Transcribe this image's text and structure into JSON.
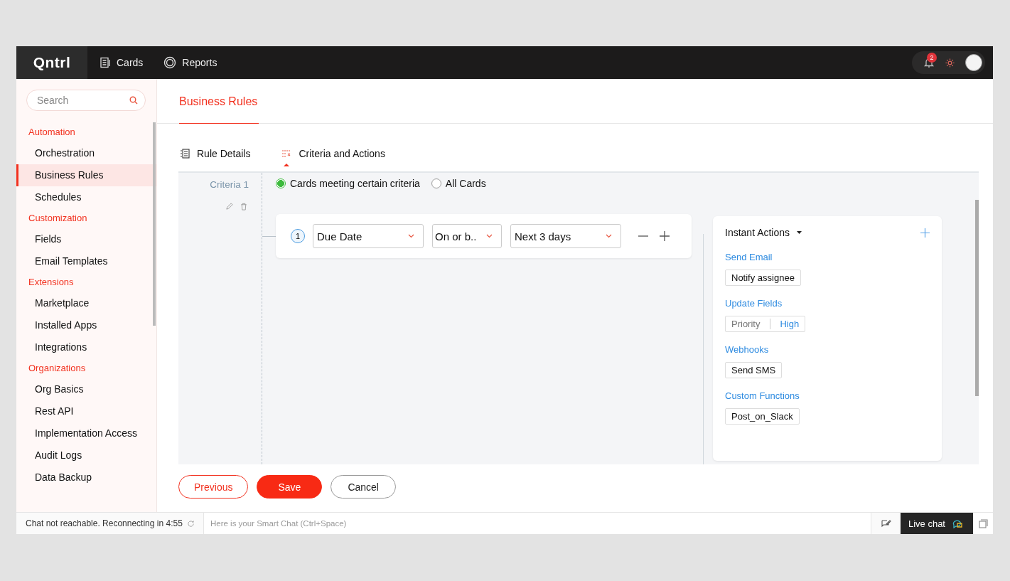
{
  "topbar": {
    "logo": "Qntrl",
    "nav": [
      {
        "label": "Cards",
        "selected": false
      },
      {
        "label": "Reports",
        "selected": false
      }
    ],
    "notification_count": "2"
  },
  "sidebar": {
    "search": {
      "placeholder": "Search"
    },
    "groups": [
      {
        "title": "Automation",
        "items": [
          {
            "label": "Orchestration",
            "selected": false
          },
          {
            "label": "Business Rules",
            "selected": true
          },
          {
            "label": "Schedules",
            "selected": false
          }
        ]
      },
      {
        "title": "Customization",
        "items": [
          {
            "label": "Fields",
            "selected": false
          },
          {
            "label": "Email Templates",
            "selected": false
          }
        ]
      },
      {
        "title": "Extensions",
        "items": [
          {
            "label": "Marketplace",
            "selected": false
          },
          {
            "label": "Installed Apps",
            "selected": false
          },
          {
            "label": "Integrations",
            "selected": false
          }
        ]
      },
      {
        "title": "Organizations",
        "items": [
          {
            "label": "Org Basics",
            "selected": false
          },
          {
            "label": "Rest API",
            "selected": false
          },
          {
            "label": "Implementation Access",
            "selected": false
          },
          {
            "label": "Audit Logs",
            "selected": false
          },
          {
            "label": "Data Backup",
            "selected": false
          }
        ]
      }
    ]
  },
  "page": {
    "title": "Business Rules",
    "tabs": [
      {
        "label": "Rule Details",
        "selected": false
      },
      {
        "label": "Criteria and Actions",
        "selected": true
      }
    ]
  },
  "criteria": {
    "label": "Criteria 1",
    "options": [
      {
        "label": "Cards meeting certain criteria",
        "selected": true
      },
      {
        "label": "All Cards",
        "selected": false
      }
    ],
    "conditions": [
      {
        "number": "1",
        "field": "Due Date",
        "operator": "On or b..",
        "value": "Next 3 days"
      }
    ]
  },
  "actions": {
    "title": "Instant Actions",
    "groups": [
      {
        "title": "Send Email",
        "items": [
          {
            "kind": "chip",
            "text": "Notify assignee"
          }
        ]
      },
      {
        "title": "Update Fields",
        "items": [
          {
            "kind": "pair",
            "key": "Priority",
            "value": "High"
          }
        ]
      },
      {
        "title": "Webhooks",
        "items": [
          {
            "kind": "chip",
            "text": "Send SMS"
          }
        ]
      },
      {
        "title": "Custom Functions",
        "items": [
          {
            "kind": "chip",
            "text": "Post_on_Slack"
          }
        ]
      }
    ]
  },
  "buttons": [
    {
      "label": "Previous",
      "kind": "secondary"
    },
    {
      "label": "Save",
      "kind": "primary"
    },
    {
      "label": "Cancel",
      "kind": "plain"
    }
  ],
  "chat_bar": {
    "status": "Chat not reachable. Reconnecting in 4:55",
    "placeholder": "Here is your Smart Chat (Ctrl+Space)",
    "live_chat": "Live chat"
  }
}
